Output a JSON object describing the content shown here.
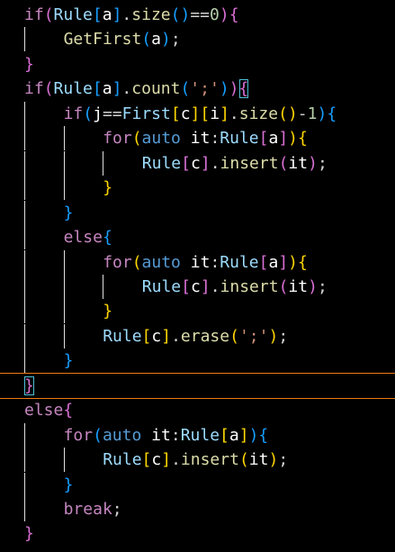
{
  "colors": {
    "keyword": "#c586c0",
    "type": "#569cd6",
    "member": "#9cdcfe",
    "function": "#dcdcaa",
    "string": "#ce9178",
    "number": "#b5cea8",
    "bracket_depth0": "#da70d6",
    "bracket_depth1": "#179fff",
    "bracket_depth2": "#ffd700",
    "current_line_border": "#f07a12"
  },
  "current_line": 16,
  "lines": [
    {
      "indent": 0,
      "tokens": [
        [
          "if",
          "kw"
        ],
        [
          "(",
          "p0"
        ],
        [
          "Rule",
          "var"
        ],
        [
          "[",
          "p1"
        ],
        [
          "a",
          "id"
        ],
        [
          "]",
          "p1"
        ],
        [
          ".",
          "pn"
        ],
        [
          "size",
          "fn"
        ],
        [
          "()",
          "p1"
        ],
        [
          "==",
          "pn"
        ],
        [
          "0",
          "num"
        ],
        [
          ")",
          "p0"
        ],
        [
          "{",
          "p0"
        ]
      ]
    },
    {
      "indent": 1,
      "tokens": [
        [
          "GetFirst",
          "fn"
        ],
        [
          "(",
          "p1"
        ],
        [
          "a",
          "id"
        ],
        [
          ")",
          "p1"
        ],
        [
          ";",
          "pn"
        ]
      ]
    },
    {
      "indent": 0,
      "tokens": [
        [
          "}",
          "p0"
        ]
      ]
    },
    {
      "indent": 0,
      "tokens": [
        [
          "if",
          "kw"
        ],
        [
          "(",
          "p0"
        ],
        [
          "Rule",
          "var"
        ],
        [
          "[",
          "p1"
        ],
        [
          "a",
          "id"
        ],
        [
          "]",
          "p1"
        ],
        [
          ".",
          "pn"
        ],
        [
          "count",
          "fn"
        ],
        [
          "(",
          "p1"
        ],
        [
          "';'",
          "str"
        ],
        [
          ")",
          "p1"
        ],
        [
          ")",
          "p0"
        ],
        [
          "{",
          "p0 box"
        ]
      ]
    },
    {
      "indent": 1,
      "tokens": [
        [
          "if",
          "kw"
        ],
        [
          "(",
          "p1"
        ],
        [
          "j",
          "id"
        ],
        [
          "==",
          "pn"
        ],
        [
          "First",
          "var"
        ],
        [
          "[",
          "p2"
        ],
        [
          "c",
          "id"
        ],
        [
          "]",
          "p2"
        ],
        [
          "[",
          "p2"
        ],
        [
          "i",
          "id"
        ],
        [
          "]",
          "p2"
        ],
        [
          ".",
          "pn"
        ],
        [
          "size",
          "fn"
        ],
        [
          "()",
          "p2"
        ],
        [
          "-",
          "pn"
        ],
        [
          "1",
          "num"
        ],
        [
          ")",
          "p1"
        ],
        [
          "{",
          "p1"
        ]
      ]
    },
    {
      "indent": 2,
      "tokens": [
        [
          "for",
          "kw"
        ],
        [
          "(",
          "p2"
        ],
        [
          "auto",
          "ty"
        ],
        [
          " ",
          "pn"
        ],
        [
          "it",
          "id"
        ],
        [
          ":",
          "pn"
        ],
        [
          "Rule",
          "var"
        ],
        [
          "[",
          "p0"
        ],
        [
          "a",
          "id"
        ],
        [
          "]",
          "p0"
        ],
        [
          ")",
          "p2"
        ],
        [
          "{",
          "p2"
        ]
      ]
    },
    {
      "indent": 3,
      "tokens": [
        [
          "Rule",
          "var"
        ],
        [
          "[",
          "p0"
        ],
        [
          "c",
          "id"
        ],
        [
          "]",
          "p0"
        ],
        [
          ".",
          "pn"
        ],
        [
          "insert",
          "fn"
        ],
        [
          "(",
          "p0"
        ],
        [
          "it",
          "id"
        ],
        [
          ")",
          "p0"
        ],
        [
          ";",
          "pn"
        ]
      ]
    },
    {
      "indent": 2,
      "tokens": [
        [
          "}",
          "p2"
        ]
      ]
    },
    {
      "indent": 1,
      "tokens": [
        [
          "}",
          "p1"
        ]
      ]
    },
    {
      "indent": 1,
      "tokens": [
        [
          "else",
          "kw"
        ],
        [
          "{",
          "p1"
        ]
      ]
    },
    {
      "indent": 2,
      "tokens": [
        [
          "for",
          "kw"
        ],
        [
          "(",
          "p2"
        ],
        [
          "auto",
          "ty"
        ],
        [
          " ",
          "pn"
        ],
        [
          "it",
          "id"
        ],
        [
          ":",
          "pn"
        ],
        [
          "Rule",
          "var"
        ],
        [
          "[",
          "p0"
        ],
        [
          "a",
          "id"
        ],
        [
          "]",
          "p0"
        ],
        [
          ")",
          "p2"
        ],
        [
          "{",
          "p2"
        ]
      ]
    },
    {
      "indent": 3,
      "tokens": [
        [
          "Rule",
          "var"
        ],
        [
          "[",
          "p0"
        ],
        [
          "c",
          "id"
        ],
        [
          "]",
          "p0"
        ],
        [
          ".",
          "pn"
        ],
        [
          "insert",
          "fn"
        ],
        [
          "(",
          "p0"
        ],
        [
          "it",
          "id"
        ],
        [
          ")",
          "p0"
        ],
        [
          ";",
          "pn"
        ]
      ]
    },
    {
      "indent": 2,
      "tokens": [
        [
          "}",
          "p2"
        ]
      ]
    },
    {
      "indent": 2,
      "tokens": [
        [
          "Rule",
          "var"
        ],
        [
          "[",
          "p2"
        ],
        [
          "c",
          "id"
        ],
        [
          "]",
          "p2"
        ],
        [
          ".",
          "pn"
        ],
        [
          "erase",
          "fn"
        ],
        [
          "(",
          "p2"
        ],
        [
          "';'",
          "str"
        ],
        [
          ")",
          "p2"
        ],
        [
          ";",
          "pn"
        ]
      ]
    },
    {
      "indent": 1,
      "tokens": [
        [
          "}",
          "p1"
        ]
      ]
    },
    {
      "indent": 0,
      "tokens": [
        [
          "}",
          "p0 box"
        ]
      ]
    },
    {
      "indent": 0,
      "tokens": [
        [
          "else",
          "kw"
        ],
        [
          "{",
          "p0"
        ]
      ]
    },
    {
      "indent": 1,
      "tokens": [
        [
          "for",
          "kw"
        ],
        [
          "(",
          "p1"
        ],
        [
          "auto",
          "ty"
        ],
        [
          " ",
          "pn"
        ],
        [
          "it",
          "id"
        ],
        [
          ":",
          "pn"
        ],
        [
          "Rule",
          "var"
        ],
        [
          "[",
          "p2"
        ],
        [
          "a",
          "id"
        ],
        [
          "]",
          "p2"
        ],
        [
          ")",
          "p1"
        ],
        [
          "{",
          "p1"
        ]
      ]
    },
    {
      "indent": 2,
      "tokens": [
        [
          "Rule",
          "var"
        ],
        [
          "[",
          "p2"
        ],
        [
          "c",
          "id"
        ],
        [
          "]",
          "p2"
        ],
        [
          ".",
          "pn"
        ],
        [
          "insert",
          "fn"
        ],
        [
          "(",
          "p2"
        ],
        [
          "it",
          "id"
        ],
        [
          ")",
          "p2"
        ],
        [
          ";",
          "pn"
        ]
      ]
    },
    {
      "indent": 1,
      "tokens": [
        [
          "}",
          "p1"
        ]
      ]
    },
    {
      "indent": 1,
      "tokens": [
        [
          "break",
          "kw"
        ],
        [
          ";",
          "pn"
        ]
      ]
    },
    {
      "indent": 0,
      "tokens": [
        [
          "}",
          "p0"
        ]
      ]
    }
  ]
}
